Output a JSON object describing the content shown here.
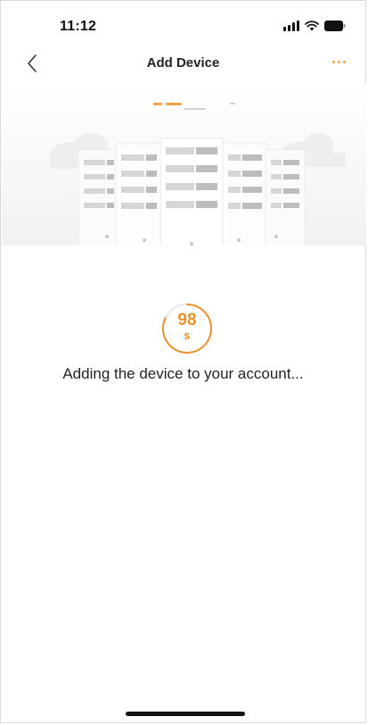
{
  "status_bar": {
    "time": "11:12",
    "icons": [
      "signal-icon",
      "wifi-icon",
      "battery-icon"
    ]
  },
  "nav": {
    "title": "Add Device",
    "back_icon": "chevron-left-icon",
    "more_icon": "more-icon"
  },
  "countdown": {
    "value": "98",
    "unit": "s",
    "progress": 0.82
  },
  "message": "Adding the device to your account...",
  "colors": {
    "accent": "#e9922e",
    "accent_light": "#f0a24a",
    "ring_track": "#e8e8e8",
    "text": "#222222"
  }
}
